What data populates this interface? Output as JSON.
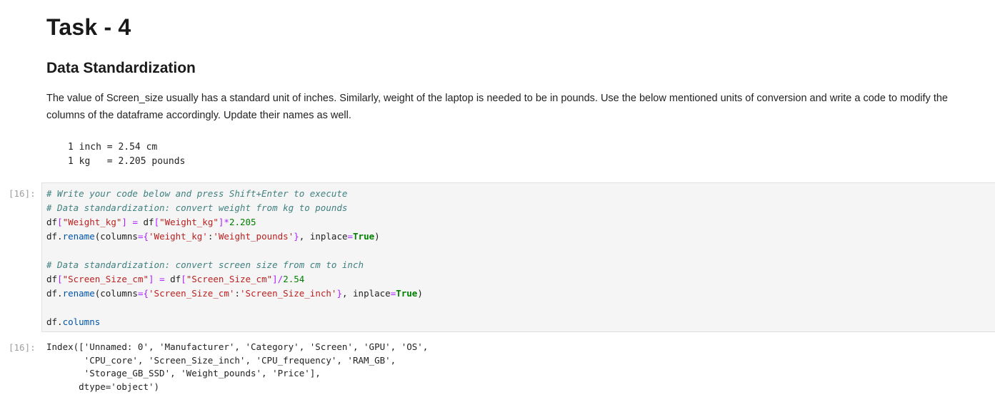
{
  "markdown": {
    "title": "Task - 4",
    "subtitle": "Data Standardization",
    "description": "The value of Screen_size usually has a standard unit of inches. Similarly, weight of the laptop is needed to be in pounds. Use the below mentioned units of conversion and write a code to modify the columns of the dataframe accordingly. Update their names as well.",
    "units": [
      "1 inch = 2.54 cm",
      "1 kg   = 2.205 pounds"
    ]
  },
  "input_cell": {
    "prompt": "[16]:",
    "lines": [
      "# Write your code below and press Shift+Enter to execute",
      "# Data standardization: convert weight from kg to pounds",
      "df[\"Weight_kg\"] = df[\"Weight_kg\"]*2.205",
      "df.rename(columns={'Weight_kg':'Weight_pounds'}, inplace=True)",
      "",
      "# Data standardization: convert screen size from cm to inch",
      "df[\"Screen_Size_cm\"] = df[\"Screen_Size_cm\"]/2.54",
      "df.rename(columns={'Screen_Size_cm':'Screen_Size_inch'}, inplace=True)",
      "",
      "df.columns"
    ]
  },
  "output_cell": {
    "prompt": "[16]:",
    "lines": [
      "Index(['Unnamed: 0', 'Manufacturer', 'Category', 'Screen', 'GPU', 'OS',",
      "       'CPU_core', 'Screen_Size_inch', 'CPU_frequency', 'RAM_GB',",
      "       'Storage_GB_SSD', 'Weight_pounds', 'Price'],",
      "      dtype='object')"
    ]
  }
}
